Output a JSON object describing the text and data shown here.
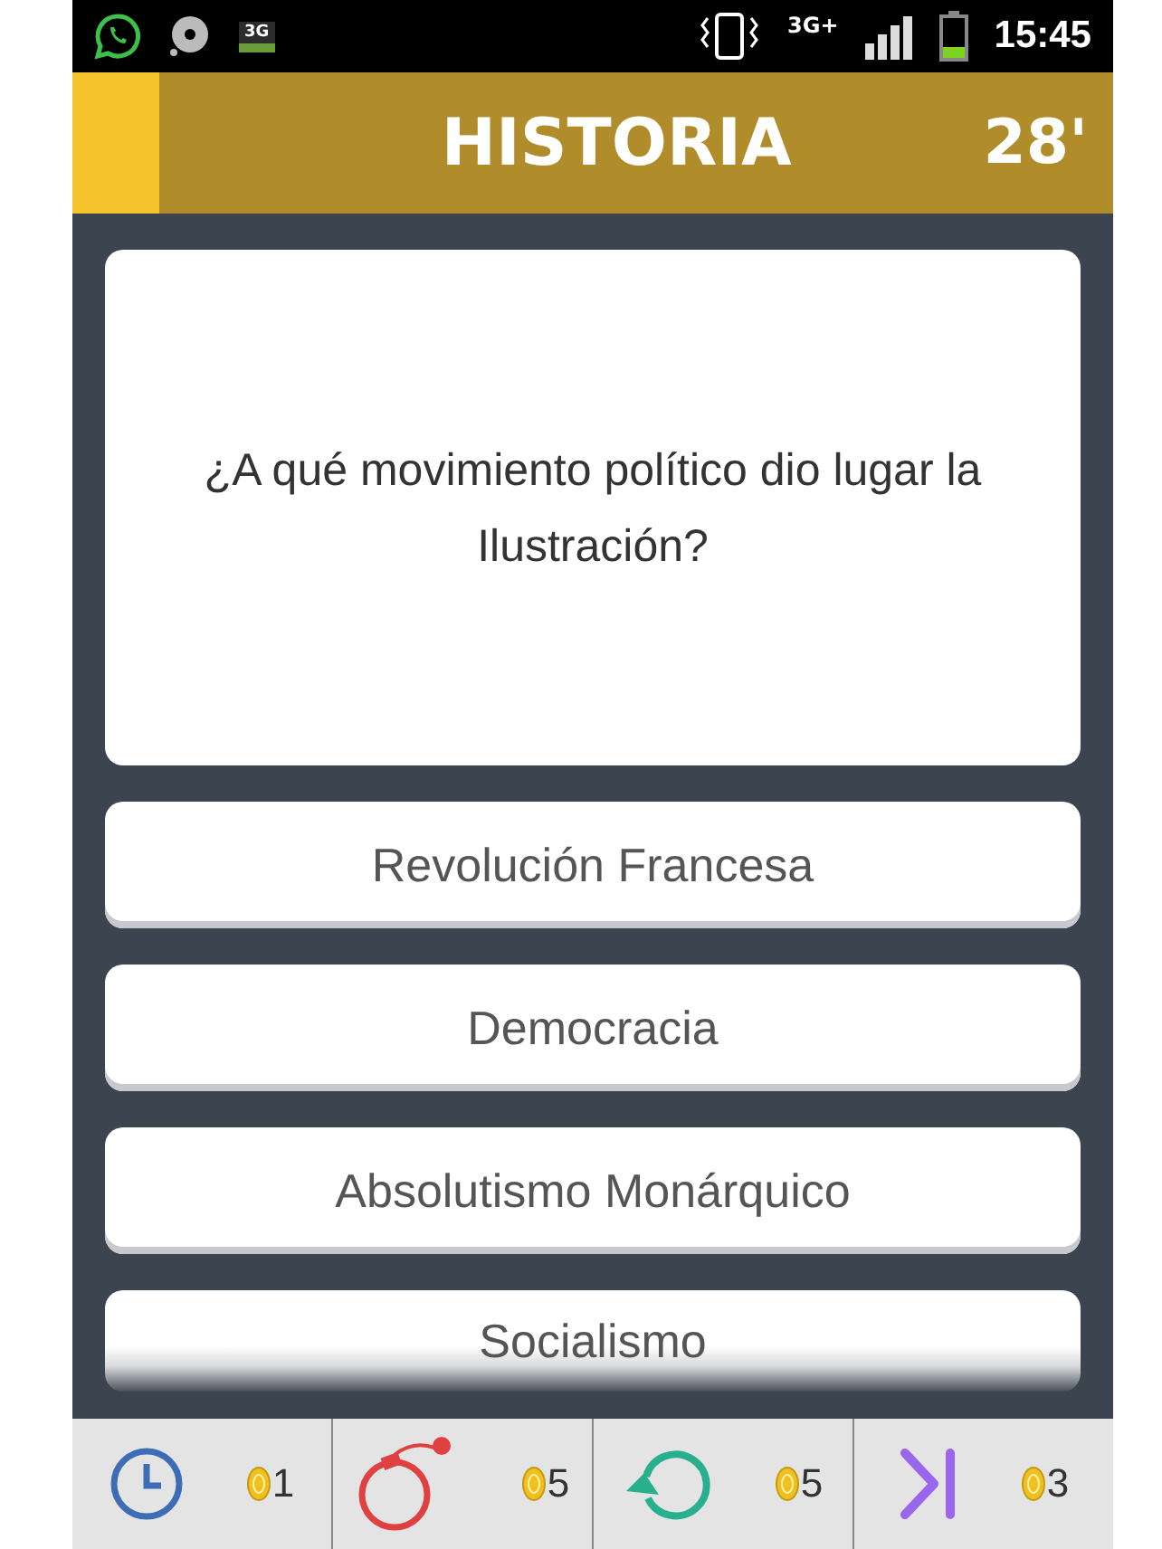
{
  "status_bar": {
    "network_badge": "3G",
    "network_type": "3G+",
    "time": "15:45"
  },
  "header": {
    "category": "HISTORIA",
    "timer": "28'"
  },
  "question": "¿A qué movimiento político dio lugar la Ilustración?",
  "answers": [
    {
      "text": "Revolución Francesa",
      "kind": "full"
    },
    {
      "text": "Democracia",
      "kind": "full"
    },
    {
      "text": "Absolutismo Monárquico",
      "kind": "full"
    },
    {
      "text": "Socialismo",
      "kind": "faded"
    }
  ],
  "powerups": [
    {
      "kind": "clock",
      "cost": "1"
    },
    {
      "kind": "bomb",
      "cost": "5"
    },
    {
      "kind": "retry",
      "cost": "5"
    },
    {
      "kind": "skip",
      "cost": "3"
    }
  ]
}
